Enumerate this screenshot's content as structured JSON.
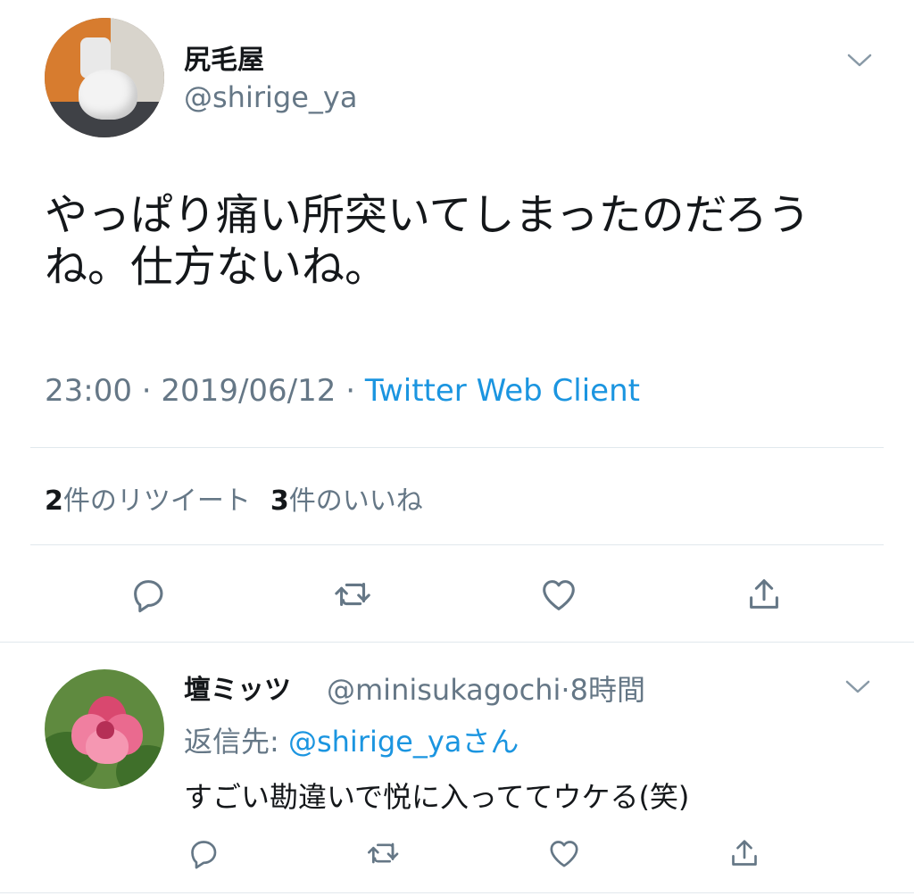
{
  "tweet": {
    "author": {
      "name": "尻毛屋",
      "handle": "@shirige_ya",
      "avatar_icon": "toilet-photo"
    },
    "text": "やっぱり痛い所突いてしまったのだろうね。仕方ないね。",
    "time": "23:00",
    "date": "2019/06/12",
    "separator": "·",
    "source": "Twitter Web Client",
    "stats": {
      "retweets_count": "2",
      "retweets_label": "件のリツイート",
      "likes_count": "3",
      "likes_label": "件のいいね"
    },
    "actions": [
      "reply-icon",
      "retweet-icon",
      "like-icon",
      "share-icon"
    ]
  },
  "reply": {
    "author": {
      "name": "壇ミッツ",
      "handle": "@minisukagochi",
      "avatar_icon": "pink-flower-photo"
    },
    "separator": "·",
    "time_ago": "8時間",
    "reply_to_label": "返信先:",
    "reply_to_handle": "@shirige_ya",
    "reply_to_suffix": "さん",
    "text": "すごい勘違いで悦に入っててウケる(笑)",
    "actions": [
      "reply-icon",
      "retweet-icon",
      "like-icon",
      "share-icon"
    ]
  },
  "colors": {
    "text_primary": "#14171a",
    "text_secondary": "#657786",
    "link": "#1b95e0",
    "divider": "#e1e8ed",
    "icon": "#657786"
  }
}
